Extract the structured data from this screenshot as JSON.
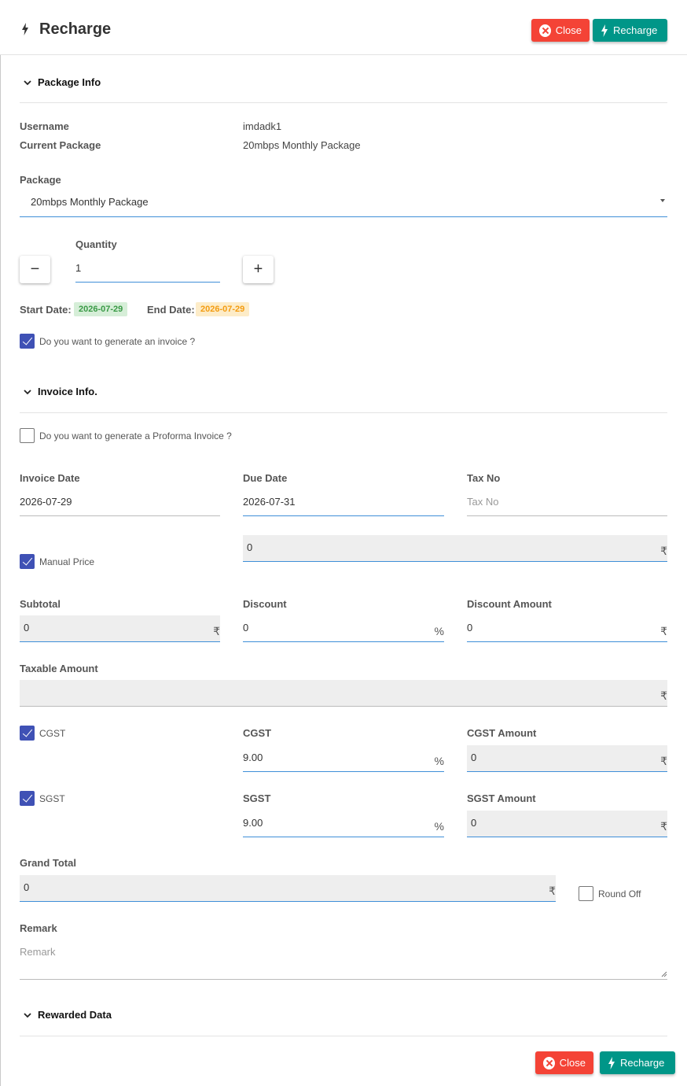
{
  "header": {
    "title": "Recharge",
    "close_label": "Close",
    "recharge_label": "Recharge"
  },
  "package_info": {
    "section_title": "Package Info",
    "username_label": "Username",
    "username_value": "imdadk1",
    "current_package_label": "Current Package",
    "current_package_value": "20mbps Monthly Package",
    "package_label": "Package",
    "package_value": "20mbps Monthly Package",
    "quantity_label": "Quantity",
    "quantity_value": "1",
    "minus": "−",
    "plus": "+",
    "start_date_label": "Start Date:",
    "start_date_value": "2026-07-29",
    "end_date_label": "End Date:",
    "end_date_value": "2026-07-29",
    "generate_invoice_label": "Do you want to generate an invoice ?"
  },
  "invoice_info": {
    "section_title": "Invoice Info.",
    "proforma_label": "Do you want to generate a Proforma Invoice ?",
    "invoice_date_label": "Invoice Date",
    "invoice_date_value": "2026-07-29",
    "due_date_label": "Due Date",
    "due_date_value": "2026-07-31",
    "tax_no_label": "Tax No",
    "tax_no_placeholder": "Tax No",
    "manual_price_label": "Manual Price",
    "manual_price_value": "0",
    "subtotal_label": "Subtotal",
    "subtotal_value": "0",
    "discount_label": "Discount",
    "discount_value": "0",
    "discount_amount_label": "Discount Amount",
    "discount_amount_value": "0",
    "taxable_amount_label": "Taxable Amount",
    "taxable_amount_value": "",
    "cgst_check_label": "CGST",
    "cgst_label": "CGST",
    "cgst_value": "9.00",
    "cgst_amount_label": "CGST Amount",
    "cgst_amount_value": "0",
    "sgst_check_label": "SGST",
    "sgst_label": "SGST",
    "sgst_value": "9.00",
    "sgst_amount_label": "SGST Amount",
    "sgst_amount_value": "0",
    "grand_total_label": "Grand Total",
    "grand_total_value": "0",
    "round_off_label": "Round Off",
    "remark_label": "Remark",
    "remark_placeholder": "Remark",
    "currency": "₹",
    "percent": "%"
  },
  "rewarded": {
    "section_title": "Rewarded Data"
  },
  "footer": {
    "close_label": "Close",
    "recharge_label": "Recharge"
  },
  "colors": {
    "close": "#f44336",
    "recharge": "#009688",
    "checkbox": "#3f51b5",
    "focus_line": "#3f8fd8"
  }
}
